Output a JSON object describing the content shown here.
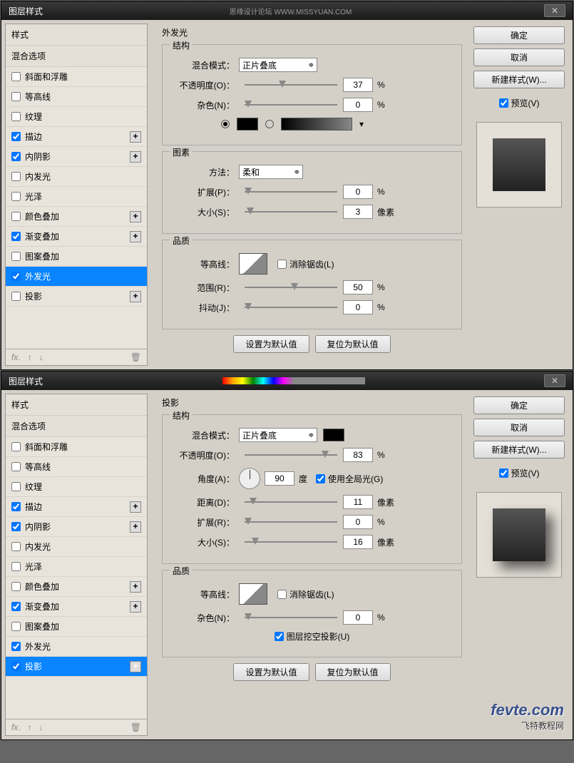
{
  "dialogs": [
    {
      "title": "图层样式",
      "credit": "思缘设计论坛   WWW.MISSYUAN.COM",
      "section_title": "外发光",
      "styles_header": "样式",
      "blend_options": "混合选项",
      "items": [
        {
          "label": "斜面和浮雕",
          "checked": false,
          "add": false
        },
        {
          "label": "等高线",
          "checked": false,
          "add": false
        },
        {
          "label": "纹理",
          "checked": false,
          "add": false
        },
        {
          "label": "描边",
          "checked": true,
          "add": true
        },
        {
          "label": "内阴影",
          "checked": true,
          "add": true
        },
        {
          "label": "内发光",
          "checked": false,
          "add": false
        },
        {
          "label": "光泽",
          "checked": false,
          "add": false
        },
        {
          "label": "颜色叠加",
          "checked": false,
          "add": true
        },
        {
          "label": "渐变叠加",
          "checked": true,
          "add": true
        },
        {
          "label": "图案叠加",
          "checked": false,
          "add": false
        },
        {
          "label": "外发光",
          "checked": true,
          "add": false,
          "selected": true
        },
        {
          "label": "投影",
          "checked": false,
          "add": true
        }
      ],
      "struct_title": "结构",
      "blend_mode_label": "混合模式：",
      "blend_mode_value": "正片叠底",
      "opacity_label": "不透明度(O)：",
      "opacity_value": "37",
      "opacity_unit": "%",
      "noise_label": "杂色(N)：",
      "noise_value": "0",
      "noise_unit": "%",
      "elements_title": "图素",
      "method_label": "方法：",
      "method_value": "柔和",
      "spread_label": "扩展(P)：",
      "spread_value": "0",
      "spread_unit": "%",
      "size_label": "大小(S)：",
      "size_value": "3",
      "size_unit": "像素",
      "quality_title": "品质",
      "contour_label": "等高线：",
      "antialias_label": "消除锯齿(L)",
      "range_label": "范围(R)：",
      "range_value": "50",
      "range_unit": "%",
      "jitter_label": "抖动(J)：",
      "jitter_value": "0",
      "jitter_unit": "%",
      "btn_default": "设置为默认值",
      "btn_reset": "复位为默认值",
      "right": {
        "ok": "确定",
        "cancel": "取消",
        "newstyle": "新建样式(W)...",
        "preview": "预览(V)"
      }
    },
    {
      "title": "图层样式",
      "section_title": "投影",
      "styles_header": "样式",
      "blend_options": "混合选项",
      "items": [
        {
          "label": "斜面和浮雕",
          "checked": false,
          "add": false
        },
        {
          "label": "等高线",
          "checked": false,
          "add": false
        },
        {
          "label": "纹理",
          "checked": false,
          "add": false
        },
        {
          "label": "描边",
          "checked": true,
          "add": true
        },
        {
          "label": "内阴影",
          "checked": true,
          "add": true
        },
        {
          "label": "内发光",
          "checked": false,
          "add": false
        },
        {
          "label": "光泽",
          "checked": false,
          "add": false
        },
        {
          "label": "颜色叠加",
          "checked": false,
          "add": true
        },
        {
          "label": "渐变叠加",
          "checked": true,
          "add": true
        },
        {
          "label": "图案叠加",
          "checked": false,
          "add": false
        },
        {
          "label": "外发光",
          "checked": true,
          "add": false
        },
        {
          "label": "投影",
          "checked": true,
          "add": true,
          "selected": true
        }
      ],
      "struct_title": "结构",
      "blend_mode_label": "混合模式：",
      "blend_mode_value": "正片叠底",
      "opacity_label": "不透明度(O)：",
      "opacity_value": "83",
      "opacity_unit": "%",
      "angle_label": "角度(A)：",
      "angle_value": "90",
      "angle_unit": "度",
      "global_light": "使用全局光(G)",
      "distance_label": "距离(D)：",
      "distance_value": "11",
      "distance_unit": "像素",
      "spread_label": "扩展(R)：",
      "spread_value": "0",
      "spread_unit": "%",
      "size_label": "大小(S)：",
      "size_value": "16",
      "size_unit": "像素",
      "quality_title": "品质",
      "contour_label": "等高线：",
      "antialias_label": "消除锯齿(L)",
      "noise_label": "杂色(N)：",
      "noise_value": "0",
      "noise_unit": "%",
      "knockout_label": "图层挖空投影(U)",
      "btn_default": "设置为默认值",
      "btn_reset": "复位为默认值",
      "right": {
        "ok": "确定",
        "cancel": "取消",
        "newstyle": "新建样式(W)...",
        "preview": "预览(V)"
      }
    }
  ],
  "watermark": {
    "main": "fevte.com",
    "sub": "飞特教程网"
  }
}
